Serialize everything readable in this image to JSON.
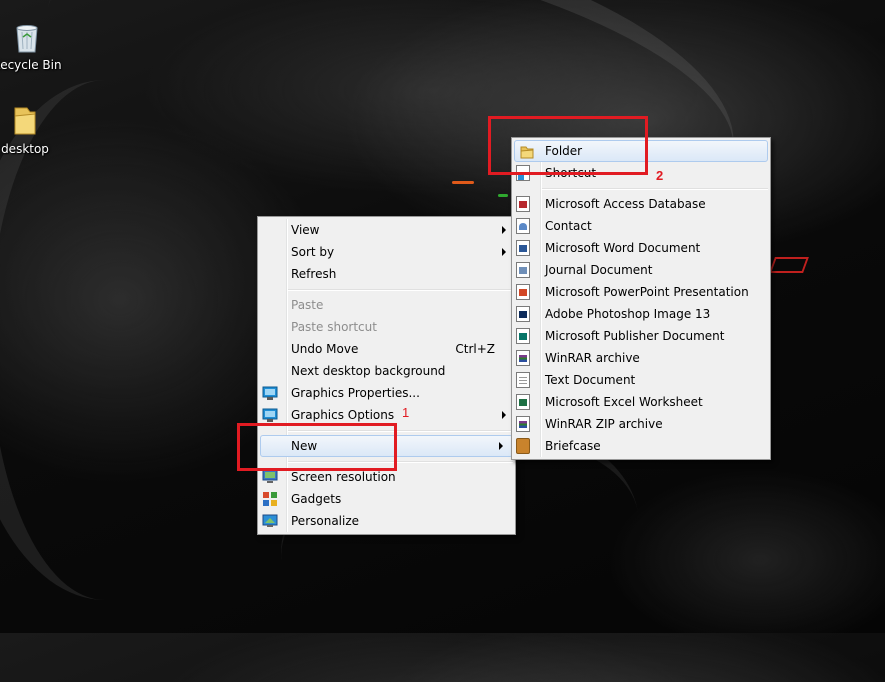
{
  "desktop": {
    "icons": [
      {
        "label": "Recycle Bin",
        "icon": "recycle-bin-icon"
      },
      {
        "label": "desktop",
        "icon": "folder-icon"
      }
    ]
  },
  "context_menu": {
    "items": [
      {
        "label": "View",
        "submenu": true
      },
      {
        "label": "Sort by",
        "submenu": true
      },
      {
        "label": "Refresh"
      },
      {
        "label": "Paste",
        "disabled": true
      },
      {
        "label": "Paste shortcut",
        "disabled": true
      },
      {
        "label": "Undo Move",
        "shortcut": "Ctrl+Z"
      },
      {
        "label": "Next desktop background"
      },
      {
        "label": "Graphics Properties...",
        "icon": "graphics-icon"
      },
      {
        "label": "Graphics Options",
        "icon": "graphics-icon",
        "submenu": true
      },
      {
        "label": "New",
        "submenu": true,
        "highlighted": true
      },
      {
        "label": "Screen resolution",
        "icon": "monitor-icon"
      },
      {
        "label": "Gadgets",
        "icon": "gadgets-icon"
      },
      {
        "label": "Personalize",
        "icon": "personalize-icon"
      }
    ]
  },
  "new_submenu": {
    "items": [
      {
        "label": "Folder",
        "icon": "folder-icon",
        "highlighted": true
      },
      {
        "label": "Shortcut",
        "icon": "shortcut-icon"
      },
      {
        "label": "Microsoft Access Database",
        "icon": "access-icon"
      },
      {
        "label": "Contact",
        "icon": "contact-icon"
      },
      {
        "label": "Microsoft Word Document",
        "icon": "word-icon"
      },
      {
        "label": "Journal Document",
        "icon": "journal-icon"
      },
      {
        "label": "Microsoft PowerPoint Presentation",
        "icon": "powerpoint-icon"
      },
      {
        "label": "Adobe Photoshop Image 13",
        "icon": "photoshop-icon"
      },
      {
        "label": "Microsoft Publisher Document",
        "icon": "publisher-icon"
      },
      {
        "label": "WinRAR archive",
        "icon": "winrar-icon"
      },
      {
        "label": "Text Document",
        "icon": "text-icon"
      },
      {
        "label": "Microsoft Excel Worksheet",
        "icon": "excel-icon"
      },
      {
        "label": "WinRAR ZIP archive",
        "icon": "winrar-zip-icon"
      },
      {
        "label": "Briefcase",
        "icon": "briefcase-icon"
      }
    ]
  },
  "annotations": {
    "step1": "1",
    "step2": "2",
    "color": "#e11b22"
  }
}
